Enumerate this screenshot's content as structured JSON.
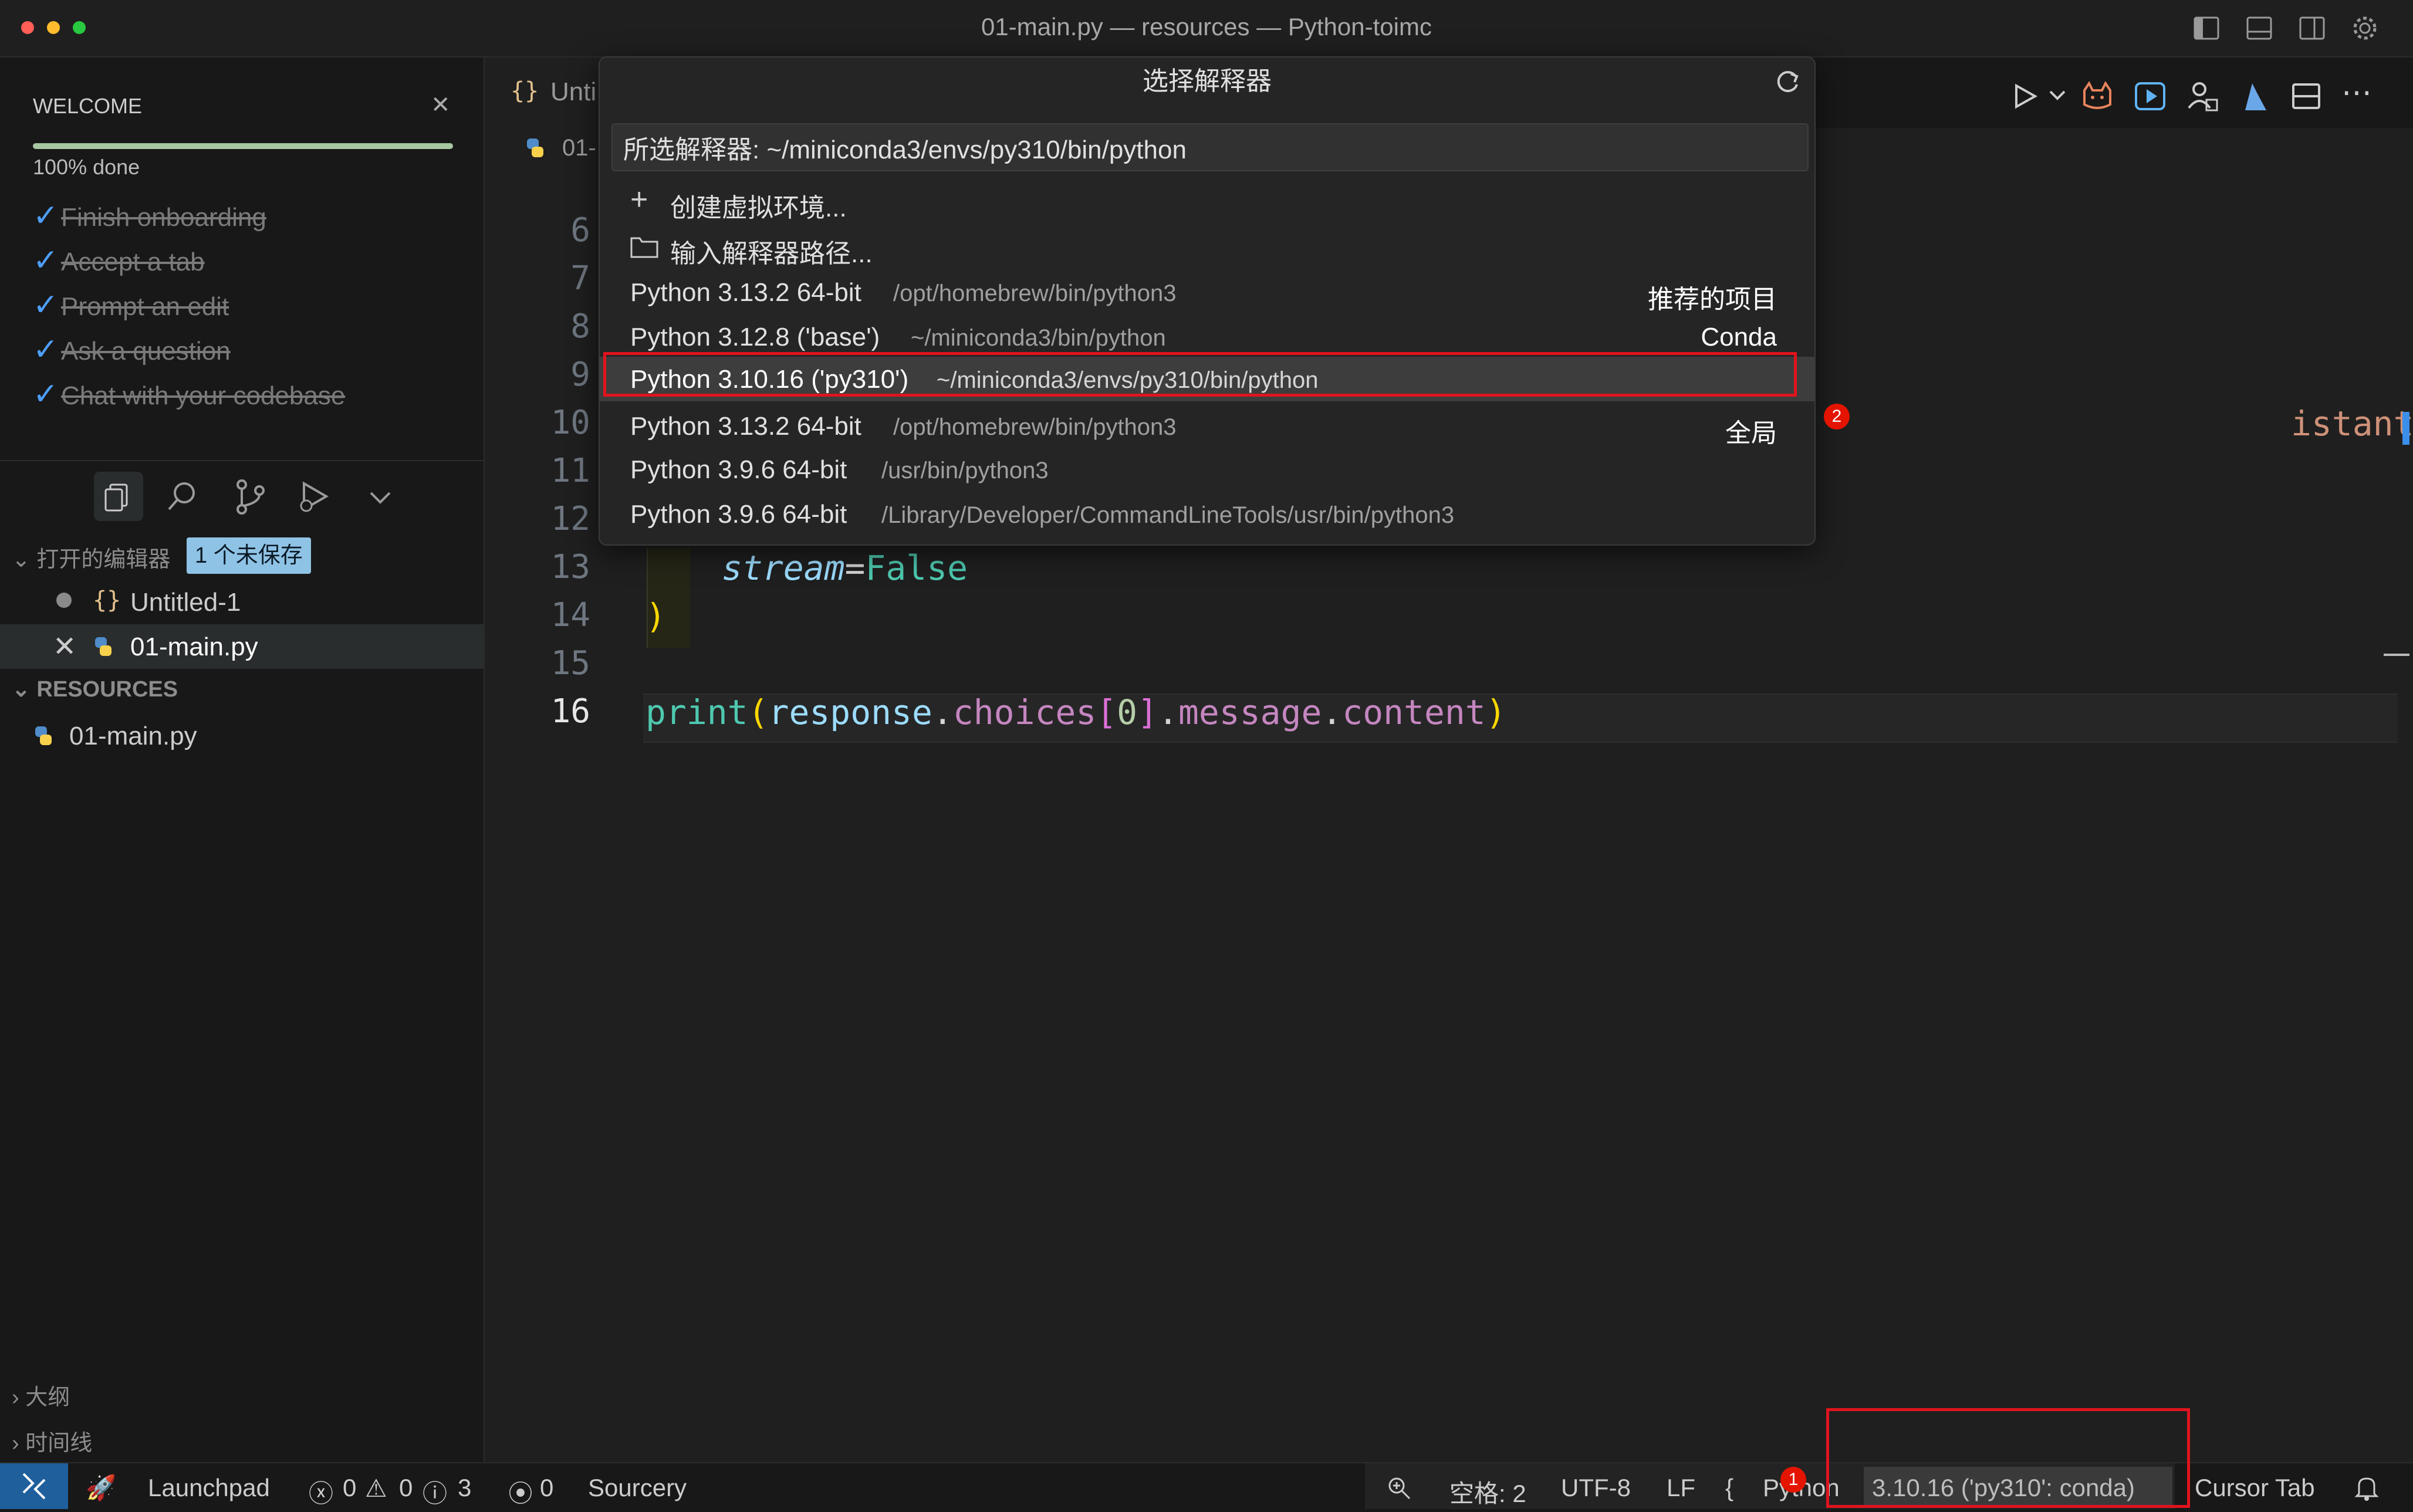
{
  "window": {
    "title": "01-main.py — resources — Python-toimc"
  },
  "welcome": {
    "title": "WELCOME",
    "progress_text": "100% done",
    "progress_value": 1.0,
    "items": [
      "Finish onboarding",
      "Accept a tab",
      "Prompt an edit",
      "Ask a question",
      "Chat with your codebase"
    ]
  },
  "explorer": {
    "open_editors_label": "打开的编辑器",
    "unsaved_badge": "1 个未保存",
    "open_files": [
      "Untitled-1",
      "01-main.py"
    ],
    "resources_label": "RESOURCES",
    "resources_files": [
      "01-main.py"
    ],
    "outline_label": "大纲",
    "timeline_label": "时间线"
  },
  "editor": {
    "tab_partial": "Unti",
    "breadcrumb_partial": "01-",
    "line_numbers": [
      "6",
      "7",
      "8",
      "9",
      "10",
      "11",
      "12",
      "13",
      "14",
      "15",
      "16"
    ],
    "line10_tail_str": "istant\"",
    "line10_tail_brace": "}",
    "line10_tail_comma": ",",
    "line13_kw": "stream",
    "line13_eq": "=",
    "line13_val": "False",
    "line14": ")",
    "line16": {
      "fn": "print",
      "p1": "(",
      "obj": "response",
      "d1": ".",
      "attr1": "choices",
      "b1": "[",
      "idx": "0",
      "b2": "]",
      "d2": ".",
      "attr2": "message",
      "d3": ".",
      "attr3": "content",
      "p2": ")"
    }
  },
  "quickpick": {
    "title": "选择解释器",
    "input_value": "所选解释器: ~/miniconda3/envs/py310/bin/python",
    "actions": [
      {
        "icon": "plus-icon",
        "label": "创建虚拟环境..."
      },
      {
        "icon": "folder-icon",
        "label": "输入解释器路径..."
      }
    ],
    "items": [
      {
        "label": "Python 3.13.2 64-bit",
        "path": "/opt/homebrew/bin/python3",
        "tag": "推荐的项目"
      },
      {
        "label": "Python 3.12.8 ('base')",
        "path": "~/miniconda3/bin/python",
        "tag": "Conda"
      },
      {
        "label": "Python 3.10.16 ('py310')",
        "path": "~/miniconda3/envs/py310/bin/python",
        "tag": ""
      },
      {
        "label": "Python 3.13.2 64-bit",
        "path": "/opt/homebrew/bin/python3",
        "tag": "全局"
      },
      {
        "label": "Python 3.9.6 64-bit",
        "path": "/usr/bin/python3",
        "tag": ""
      },
      {
        "label": "Python 3.9.6 64-bit",
        "path": "/Library/Developer/CommandLineTools/usr/bin/python3",
        "tag": ""
      }
    ],
    "badge_count": "2"
  },
  "statusbar": {
    "launchpad": "Launchpad",
    "errors": "0",
    "warnings": "0",
    "infos": "3",
    "ports": "0",
    "sourcery": "Sourcery",
    "spaces": "空格: 2",
    "encoding": "UTF-8",
    "eol": "LF",
    "language": "Python",
    "language_badge": "1",
    "interpreter": "3.10.16 ('py310': conda)",
    "cursor_tab": "Cursor Tab"
  },
  "colors": {
    "highlight_box": "#e0141e",
    "accent": "#4d9fff",
    "badge_red": "#e51400"
  }
}
